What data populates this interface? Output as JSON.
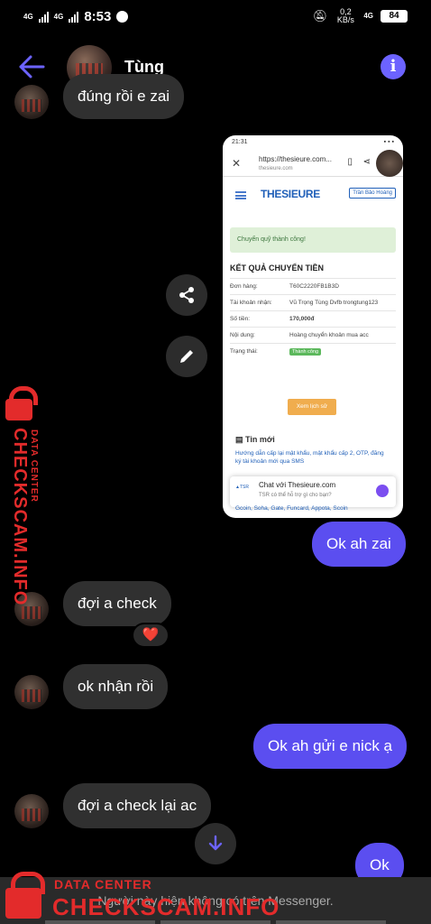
{
  "status_bar": {
    "net1": "4G",
    "net2": "4G",
    "time": "8:53",
    "speed": "0,2 KB/s",
    "net3": "4G",
    "battery": "84"
  },
  "header": {
    "back_icon": "arrow-left-icon",
    "contact_name": "Tùng",
    "info_icon": "info-icon",
    "accent_color": "#6c63ff"
  },
  "messages": {
    "partial_top": "đúng rồi e zai",
    "share_icon": "share-icon",
    "edit_icon": "pencil-icon",
    "m1": "Ok ah zai",
    "m2": "đợi a check",
    "m2_reaction": "❤️",
    "m3": "ok nhận rồi",
    "m4": "Ok ah gửi e nick ạ",
    "m5": "đợi a check lại ac",
    "m6": "Ok",
    "outgoing_color": "#5b4ef0",
    "incoming_color": "#303030"
  },
  "screenshot": {
    "status_time": "21:31",
    "url": "https://thesieure.com...",
    "url_sub": "thesieure.com",
    "logo": "THESIEURE",
    "user": "Trần Bảo Hoàng",
    "alert": "Chuyển quỹ thành công!",
    "heading": "KẾT QUẢ CHUYỂN TIỀN",
    "rows": [
      {
        "k": "Đơn hàng:",
        "v": "T60C2220FB1B3D"
      },
      {
        "k": "Tài khoản nhận:",
        "v": "Vũ Trọng Tùng Dvfb trongtung123"
      },
      {
        "k": "Số tiền:",
        "v": "170,000đ"
      },
      {
        "k": "Nội dung:",
        "v": "Hoàng chuyển khoản mua acc"
      },
      {
        "k": "Trạng thái:",
        "v": "Thành công"
      }
    ],
    "history_button": "Xem lịch sử",
    "news_heading": "Tin mới",
    "news_link": "Hướng dẫn cấp lại mật khẩu, mật khẩu cấp 2, OTP, đăng ký tài khoản mới qua SMS",
    "chat_title": "Chat với Thesieure.com",
    "chat_sub": "TSR có thể hỗ trợ gì cho bạn?",
    "cut_text": "Gcoin, Soha, Gate, Funcard, Appota, Scoin"
  },
  "watermark": {
    "brand": "CHECKSCAM.INFO",
    "label": "DATA CENTER",
    "color": "#e32b2b"
  },
  "footer": {
    "notice": "Người này hiện không có trên Messenger.",
    "scroll_icon": "arrow-down-icon"
  }
}
